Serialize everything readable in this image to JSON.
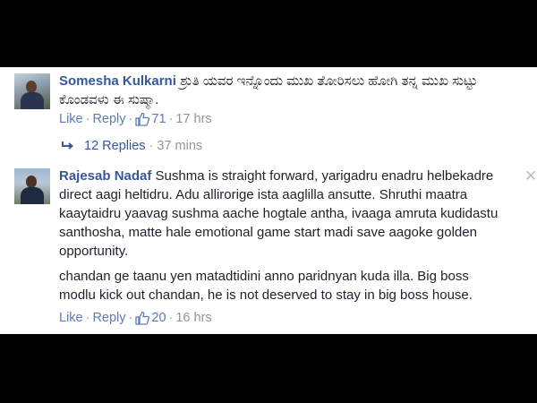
{
  "comments": [
    {
      "author": "Somesha Kulkarni",
      "text": "ಶ್ರುತಿ ಯವರ ಇನ್ನೊಂದು ಮುಖ ತೋರಿಸಲು ಹೋಗಿ ತನ್ನ ಮುಖ ಸುಟ್ಟು ಕೊಂಡವಳು ಈ ಸುಷ್ಮಾ.",
      "like_label": "Like",
      "reply_label": "Reply",
      "like_count": "71",
      "time": "17 hrs",
      "replies_label": "12 Replies",
      "replies_time": "37 mins"
    },
    {
      "author": "Rajesab Nadaf",
      "text": "Sushma is straight forward, yarigadru enadru helbekadre direct aagi heltidru. Adu allirorige ista aaglilla ansutte. Shruthi maatra kaaytaidru yaavag sushma aache hogtale antha, ivaaga amruta kudidastu santhosha, matte hale emotional game start madi save aagoke golden opportunity.",
      "text2": "chandan ge taanu yen matadtidini anno paridnyan kuda illa. Big boss modlu kick out chandan, he is not deserved to stay in big boss house.",
      "like_label": "Like",
      "reply_label": "Reply",
      "like_count": "20",
      "time": "16 hrs",
      "close_symbol": "✕"
    }
  ],
  "separator": "·",
  "colors": {
    "link": "#365899",
    "meta": "#90949c",
    "text": "#1d2129"
  }
}
